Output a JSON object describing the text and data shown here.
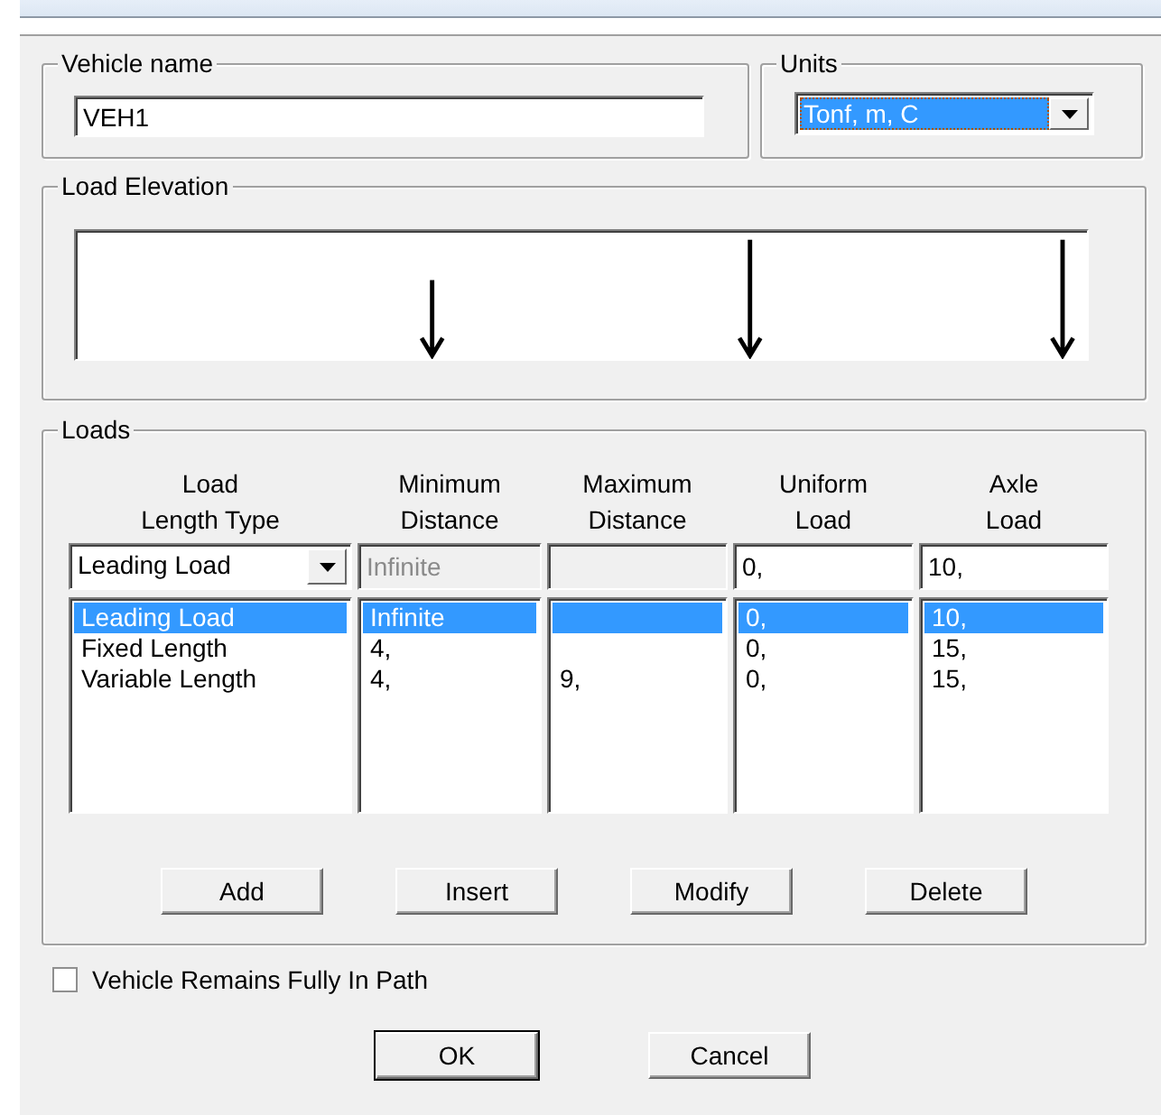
{
  "vehicle_name": {
    "label": "Vehicle name",
    "value": "VEH1"
  },
  "units": {
    "label": "Units",
    "value": "Tonf, m, C",
    "highlighted": true
  },
  "load_elevation": {
    "label": "Load Elevation"
  },
  "loads": {
    "label": "Loads",
    "columns": [
      {
        "header": "Load\nLength Type"
      },
      {
        "header": "Minimum\nDistance"
      },
      {
        "header": "Maximum\nDistance"
      },
      {
        "header": "Uniform\nLoad"
      },
      {
        "header": "Axle\nLoad"
      }
    ],
    "edit_row": [
      {
        "kind": "dropdown",
        "value": "Leading Load",
        "disabled": false
      },
      {
        "kind": "text",
        "value": "Infinite",
        "disabled": true
      },
      {
        "kind": "text",
        "disabled": true
      },
      {
        "kind": "text",
        "value": "0,",
        "disabled": false
      },
      {
        "kind": "text",
        "value": "10,",
        "disabled": false
      }
    ],
    "rows": [
      {
        "selected": true,
        "type": "Leading Load",
        "min_distance": "Infinite",
        "uniform_load": "0,",
        "axle_load": "10,"
      },
      {
        "selected": false,
        "type": "Fixed Length",
        "min_distance": "4,",
        "uniform_load": "0,",
        "axle_load": "15,"
      },
      {
        "selected": false,
        "type": "Variable Length",
        "min_distance": "4,",
        "max_distance": "9,",
        "uniform_load": "0,",
        "axle_load": "15,"
      }
    ],
    "buttons": [
      "Add",
      "Insert",
      "Modify",
      "Delete"
    ]
  },
  "fully_in_path": {
    "label": "Vehicle Remains Fully In Path",
    "checked": false
  },
  "dialog_buttons": [
    {
      "label": "OK",
      "default": true
    },
    {
      "label": "Cancel",
      "default": false
    }
  ]
}
